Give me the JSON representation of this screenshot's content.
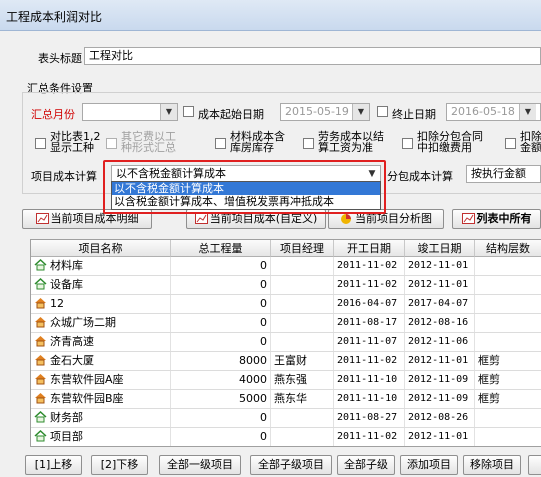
{
  "window": {
    "title": "工程成本利润对比"
  },
  "form": {
    "title_label": "表头标题",
    "title_value": "工程对比",
    "summary_group": "汇总条件设置",
    "month_label": "汇总月份",
    "month_value": "",
    "start_date_label": "成本起始日期",
    "start_date_value": "2015-05-19",
    "end_date_label": "终止日期",
    "end_date_value": "2016-05-18"
  },
  "options": [
    {
      "line1": "对比表1,2",
      "line2": "显示工种",
      "disabled": false
    },
    {
      "line1": "其它费以工",
      "line2": "种形式汇总",
      "disabled": true
    },
    {
      "line1": "材料成本含",
      "line2": "库房库存",
      "disabled": false
    },
    {
      "line1": "劳务成本以结",
      "line2": "算工资为准",
      "disabled": false
    },
    {
      "line1": "扣除分包合同",
      "line2": "中扣缴费用",
      "disabled": false
    },
    {
      "line1": "扣除",
      "line2": "金额",
      "disabled": false
    }
  ],
  "cost_calc": {
    "label": "项目成本计算",
    "selected": "以不含税金额计算成本",
    "options": [
      "以不含税金额计算成本",
      "以含税金额计算成本、增值税发票再冲抵成本"
    ],
    "sub_label": "分包成本计算",
    "sub_selected": "按执行金额"
  },
  "toolbar": {
    "current_detail": "当前项目成本明细",
    "current_custom": "当前项目成本(自定义)",
    "current_chart": "当前项目分析图",
    "list_all": "列表中所有"
  },
  "table": {
    "columns": [
      "项目名称",
      "总工程量",
      "项目经理",
      "开工日期",
      "竣工日期",
      "结构层数"
    ],
    "rows": [
      {
        "icon": "green-house-icon",
        "name": "材料库",
        "qty": "0",
        "mgr": "",
        "start": "2011-11-02",
        "end": "2012-11-01",
        "struct": ""
      },
      {
        "icon": "green-house-icon",
        "name": "设备库",
        "qty": "0",
        "mgr": "",
        "start": "2011-11-02",
        "end": "2012-11-01",
        "struct": ""
      },
      {
        "icon": "orange-house-icon",
        "name": "12",
        "qty": "0",
        "mgr": "",
        "start": "2016-04-07",
        "end": "2017-04-07",
        "struct": ""
      },
      {
        "icon": "orange-house-icon",
        "name": "众城广场二期",
        "qty": "0",
        "mgr": "",
        "start": "2011-08-17",
        "end": "2012-08-16",
        "struct": ""
      },
      {
        "icon": "orange-house-icon",
        "name": "济青高速",
        "qty": "0",
        "mgr": "",
        "start": "2011-11-07",
        "end": "2012-11-06",
        "struct": ""
      },
      {
        "icon": "orange-house-icon",
        "name": "金石大厦",
        "qty": "8000",
        "mgr": "王富财",
        "start": "2011-11-02",
        "end": "2012-11-01",
        "struct": "框剪"
      },
      {
        "icon": "orange-house-icon",
        "name": "东营软件园A座",
        "qty": "4000",
        "mgr": "燕东强",
        "start": "2011-11-10",
        "end": "2012-11-09",
        "struct": "框剪"
      },
      {
        "icon": "orange-house-icon",
        "name": "东营软件园B座",
        "qty": "5000",
        "mgr": "燕东华",
        "start": "2011-11-10",
        "end": "2012-11-09",
        "struct": "框剪"
      },
      {
        "icon": "green-house-icon",
        "name": "财务部",
        "qty": "0",
        "mgr": "",
        "start": "2011-08-27",
        "end": "2012-08-26",
        "struct": ""
      },
      {
        "icon": "green-house-icon",
        "name": "项目部",
        "qty": "0",
        "mgr": "",
        "start": "2011-11-02",
        "end": "2012-11-01",
        "struct": ""
      }
    ]
  },
  "bottom_buttons": {
    "move_up": "[1]上移",
    "move_down": "[2]下移",
    "all_level1": "全部一级项目",
    "all_sub_projects": "全部子级项目",
    "all_sub": "全部子级",
    "add_project": "添加项目",
    "remove_project": "移除项目"
  },
  "colors": {
    "highlight_red": "#e02020",
    "selection_blue": "#3378d6",
    "month_label_red": "#d00000"
  }
}
